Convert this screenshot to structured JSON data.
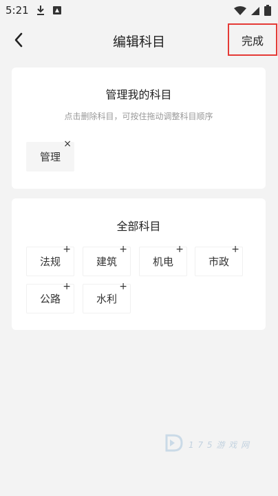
{
  "status_bar": {
    "time": "5:21"
  },
  "header": {
    "title": "编辑科目",
    "done_label": "完成"
  },
  "my_subjects": {
    "title": "管理我的科目",
    "hint": "点击删除科目，可按住拖动调整科目顺序",
    "items": [
      {
        "label": "管理",
        "mark": "×"
      }
    ]
  },
  "all_subjects": {
    "title": "全部科目",
    "items": [
      {
        "label": "法规",
        "mark": "+"
      },
      {
        "label": "建筑",
        "mark": "+"
      },
      {
        "label": "机电",
        "mark": "+"
      },
      {
        "label": "市政",
        "mark": "+"
      },
      {
        "label": "公路",
        "mark": "+"
      },
      {
        "label": "水利",
        "mark": "+"
      }
    ]
  },
  "watermark": {
    "text": "1 7 5 游 戏 网"
  },
  "colors": {
    "highlight_border": "#e53935",
    "background": "#f3f3f3",
    "card": "#ffffff"
  }
}
